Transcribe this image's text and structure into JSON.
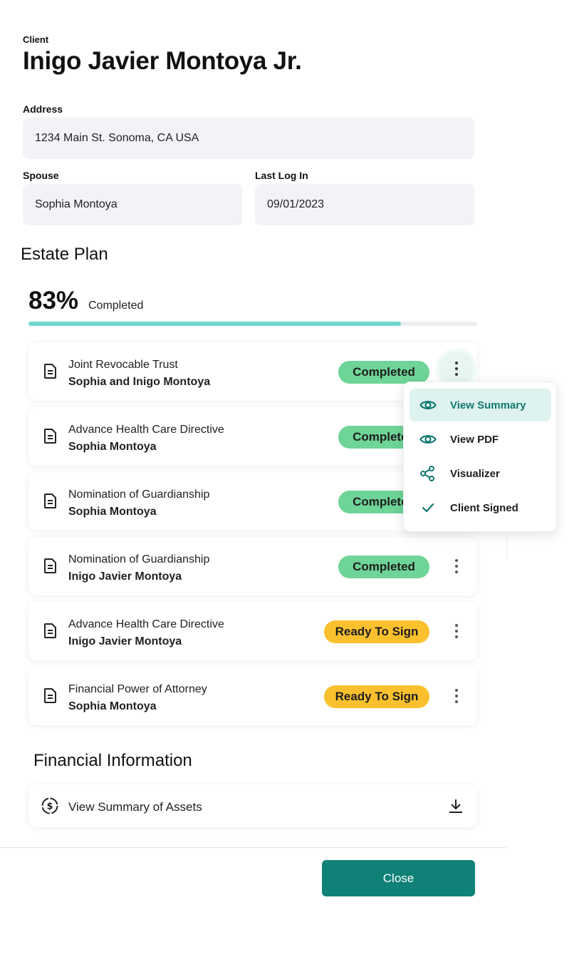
{
  "client": {
    "label": "Client",
    "name": "Inigo Javier Montoya Jr."
  },
  "address": {
    "label": "Address",
    "value": "1234 Main St. Sonoma, CA USA"
  },
  "spouse": {
    "label": "Spouse",
    "value": "Sophia Montoya"
  },
  "last_login": {
    "label": "Last Log In",
    "value": "09/01/2023"
  },
  "estate_plan": {
    "title": "Estate Plan",
    "percent_text": "83%",
    "percent_value": 83,
    "completed_label": "Completed",
    "documents": [
      {
        "title": "Joint Revocable Trust",
        "subtitle": "Sophia and Inigo Montoya",
        "status": "Completed"
      },
      {
        "title": "Advance Health Care Directive",
        "subtitle": "Sophia Montoya",
        "status": "Completed"
      },
      {
        "title": "Nomination of Guardianship",
        "subtitle": "Sophia Montoya",
        "status": "Completed"
      },
      {
        "title": "Nomination of Guardianship",
        "subtitle": "Inigo Javier Montoya",
        "status": "Completed"
      },
      {
        "title": "Advance Health Care Directive",
        "subtitle": "Inigo Javier Montoya",
        "status": "Ready To Sign"
      },
      {
        "title": "Financial Power of Attorney",
        "subtitle": "Sophia Montoya",
        "status": "Ready To Sign"
      }
    ]
  },
  "menu": {
    "items": [
      {
        "label": "View Summary",
        "icon": "eye-icon"
      },
      {
        "label": "View PDF",
        "icon": "eye-icon"
      },
      {
        "label": "Visualizer",
        "icon": "share-icon"
      },
      {
        "label": "Client Signed",
        "icon": "check-icon"
      }
    ]
  },
  "financial": {
    "title": "Financial Information",
    "assets_label": "View Summary of Assets"
  },
  "footer": {
    "close_label": "Close"
  },
  "colors": {
    "accent": "#0f8177",
    "completed_badge": "#6ed497",
    "ready_badge": "#fbc02d",
    "progress": "#6fd7cd"
  }
}
